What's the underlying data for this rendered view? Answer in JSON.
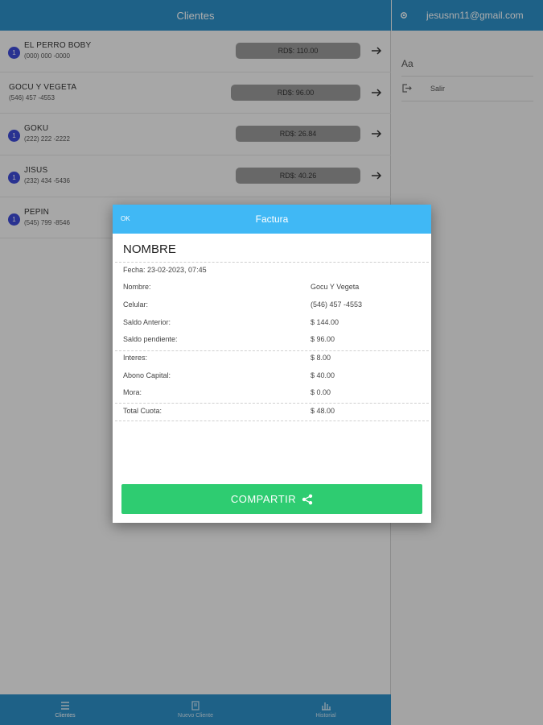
{
  "header": {
    "title": "Clientes"
  },
  "clients": [
    {
      "badge": "1",
      "name": "EL PERRO BOBY",
      "phone": "(000) 000 -0000",
      "amount": "RD$: 110.00"
    },
    {
      "badge": "",
      "name": "GOCU Y VEGETA",
      "phone": "(546) 457 -4553",
      "amount": "RD$: 96.00"
    },
    {
      "badge": "1",
      "name": "GOKU",
      "phone": "(222) 222 -2222",
      "amount": "RD$: 26.84"
    },
    {
      "badge": "1",
      "name": "JISUS",
      "phone": "(232) 434 -5436",
      "amount": "RD$: 40.26"
    },
    {
      "badge": "1",
      "name": "PEPIN",
      "phone": "(545) 799 -8546",
      "amount": ""
    }
  ],
  "bottom_nav": [
    {
      "label": "Clientes",
      "icon": "list-icon",
      "active": true
    },
    {
      "label": "Nuevo Cliente",
      "icon": "document-icon",
      "active": false
    },
    {
      "label": "Historial",
      "icon": "chart-icon",
      "active": false
    }
  ],
  "side_menu": {
    "email": "jesusnn11@gmail.com",
    "font_label": "Aa",
    "logout_label": "Salir"
  },
  "dialog": {
    "ok_label": "OK",
    "title": "Factura",
    "name_heading": "NOMBRE",
    "date": "Fecha: 23-02-2023, 07:45",
    "rows": [
      {
        "label": "Nombre:",
        "value": "Gocu Y Vegeta"
      },
      {
        "label": "Celular:",
        "value": "(546) 457 -4553"
      },
      {
        "label": "Saldo Anterior:",
        "value": "$ 144.00"
      },
      {
        "label": "Saldo pendiente:",
        "value": "$ 96.00"
      },
      {
        "label": "Interes:",
        "value": "$ 8.00"
      },
      {
        "label": "Abono Capital:",
        "value": "$ 40.00"
      },
      {
        "label": "Mora:",
        "value": "$ 0.00"
      },
      {
        "label": "Total Cuota:",
        "value": "$ 48.00"
      }
    ],
    "share_label": "COMPARTIR"
  },
  "colors": {
    "primary": "#2d8fc7",
    "dialog_header": "#40b8f5",
    "share_button": "#2ecc71",
    "badge": "#3d4ad6"
  }
}
